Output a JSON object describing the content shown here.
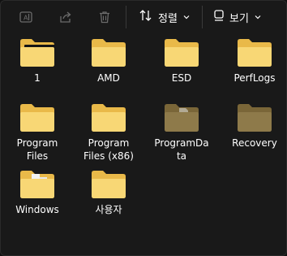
{
  "toolbar": {
    "sort_label": "정렬",
    "view_label": "보기"
  },
  "files": [
    {
      "name": "1",
      "variant": "dark-content"
    },
    {
      "name": "AMD",
      "variant": "normal"
    },
    {
      "name": "ESD",
      "variant": "normal"
    },
    {
      "name": "PerfLogs",
      "variant": "normal"
    },
    {
      "name": "Program\nFiles",
      "variant": "normal"
    },
    {
      "name": "Program\nFiles (x86)",
      "variant": "normal"
    },
    {
      "name": "ProgramDa\nta",
      "variant": "hidden"
    },
    {
      "name": "Recovery",
      "variant": "hidden-plain"
    },
    {
      "name": "Windows",
      "variant": "doc"
    },
    {
      "name": "사용자",
      "variant": "normal"
    }
  ],
  "colors": {
    "background": "#191919",
    "folder_front": "#F8D775",
    "folder_back": "#E9B949",
    "folder_hidden_front": "#8E7A4A",
    "folder_hidden_back": "#7A6638",
    "text": "#FFFFFF",
    "icon_disabled": "#6B6B6B"
  }
}
